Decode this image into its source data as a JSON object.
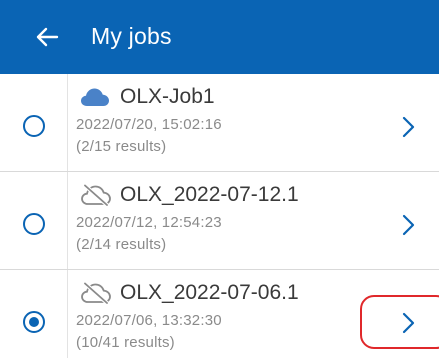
{
  "colors": {
    "brand": "#0a64b4",
    "cloud_filled": "#4a82c8",
    "cloud_offline": "#8a8a8a",
    "annotation": "#e0282b"
  },
  "header": {
    "title": "My jobs",
    "back_icon": "arrow-left-icon"
  },
  "jobs": [
    {
      "name": "OLX-Job1",
      "date": "2022/07/20, 15:02:16",
      "results": "(2/15 results)",
      "cloud_icon": "cloud-icon",
      "selected": false
    },
    {
      "name": "OLX_2022-07-12.1",
      "date": "2022/07/12, 12:54:23",
      "results": "(2/14 results)",
      "cloud_icon": "cloud-off-icon",
      "selected": false
    },
    {
      "name": "OLX_2022-07-06.1",
      "date": "2022/07/06, 13:32:30",
      "results": "(10/41 results)",
      "cloud_icon": "cloud-off-icon",
      "selected": true
    }
  ]
}
